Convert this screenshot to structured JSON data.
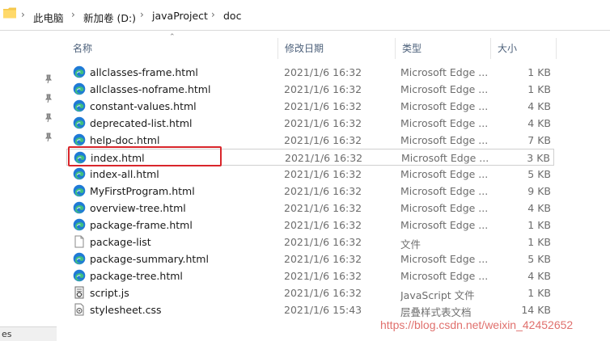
{
  "address_bar": {
    "crumbs": [
      "此电脑",
      "新加卷 (D:)",
      "javaProject",
      "doc"
    ],
    "separator": "›"
  },
  "columns": {
    "name": "名称",
    "date": "修改日期",
    "type": "类型",
    "size": "大小"
  },
  "files": [
    {
      "name": "allclasses-frame.html",
      "date": "2021/1/6 16:32",
      "type": "Microsoft Edge ...",
      "size": "1 KB",
      "icon": "edge-icon"
    },
    {
      "name": "allclasses-noframe.html",
      "date": "2021/1/6 16:32",
      "type": "Microsoft Edge ...",
      "size": "1 KB",
      "icon": "edge-icon"
    },
    {
      "name": "constant-values.html",
      "date": "2021/1/6 16:32",
      "type": "Microsoft Edge ...",
      "size": "4 KB",
      "icon": "edge-icon"
    },
    {
      "name": "deprecated-list.html",
      "date": "2021/1/6 16:32",
      "type": "Microsoft Edge ...",
      "size": "4 KB",
      "icon": "edge-icon"
    },
    {
      "name": "help-doc.html",
      "date": "2021/1/6 16:32",
      "type": "Microsoft Edge ...",
      "size": "7 KB",
      "icon": "edge-icon"
    },
    {
      "name": "index.html",
      "date": "2021/1/6 16:32",
      "type": "Microsoft Edge ...",
      "size": "3 KB",
      "icon": "edge-icon",
      "selected": true
    },
    {
      "name": "index-all.html",
      "date": "2021/1/6 16:32",
      "type": "Microsoft Edge ...",
      "size": "5 KB",
      "icon": "edge-icon"
    },
    {
      "name": "MyFirstProgram.html",
      "date": "2021/1/6 16:32",
      "type": "Microsoft Edge ...",
      "size": "9 KB",
      "icon": "edge-icon"
    },
    {
      "name": "overview-tree.html",
      "date": "2021/1/6 16:32",
      "type": "Microsoft Edge ...",
      "size": "4 KB",
      "icon": "edge-icon"
    },
    {
      "name": "package-frame.html",
      "date": "2021/1/6 16:32",
      "type": "Microsoft Edge ...",
      "size": "1 KB",
      "icon": "edge-icon"
    },
    {
      "name": "package-list",
      "date": "2021/1/6 16:32",
      "type": "文件",
      "size": "1 KB",
      "icon": "file-icon"
    },
    {
      "name": "package-summary.html",
      "date": "2021/1/6 16:32",
      "type": "Microsoft Edge ...",
      "size": "5 KB",
      "icon": "edge-icon"
    },
    {
      "name": "package-tree.html",
      "date": "2021/1/6 16:32",
      "type": "Microsoft Edge ...",
      "size": "4 KB",
      "icon": "edge-icon"
    },
    {
      "name": "script.js",
      "date": "2021/1/6 16:32",
      "type": "JavaScript 文件",
      "size": "1 KB",
      "icon": "script-icon"
    },
    {
      "name": "stylesheet.css",
      "date": "2021/1/6 15:43",
      "type": "层叠样式表文档",
      "size": "14 KB",
      "icon": "css-icon"
    }
  ],
  "nav_scrap": "es",
  "watermark": "https://blog.csdn.net/weixin_42452652",
  "colors": {
    "highlight": "#d9262b",
    "edge_blue": "#1f7ad6",
    "edge_green": "#3fbf7f",
    "header_text": "#4c607a"
  }
}
